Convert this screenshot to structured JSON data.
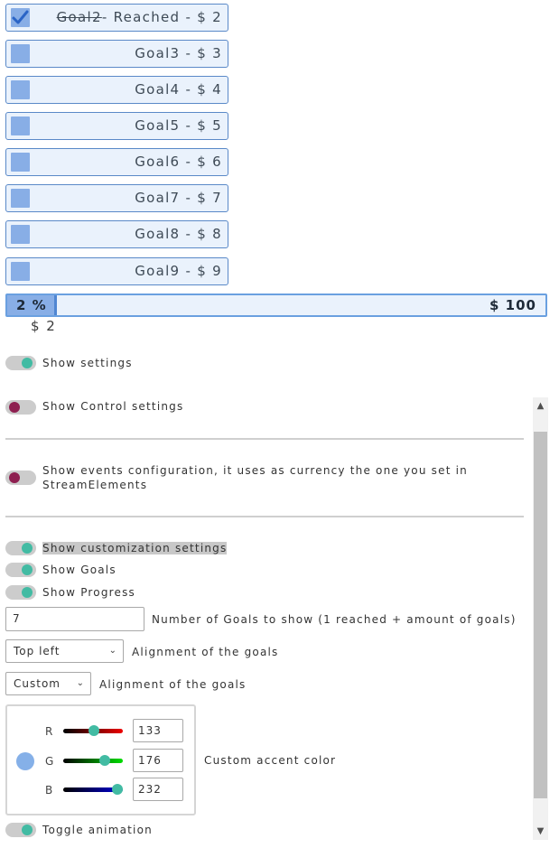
{
  "goals": [
    {
      "name": "Goal2",
      "suffix": "- Reached - $ 2",
      "reached": true
    },
    {
      "label": "Goal3 - $ 3",
      "reached": false
    },
    {
      "label": "Goal4 - $ 4",
      "reached": false
    },
    {
      "label": "Goal5 - $ 5",
      "reached": false
    },
    {
      "label": "Goal6 - $ 6",
      "reached": false
    },
    {
      "label": "Goal7 - $ 7",
      "reached": false
    },
    {
      "label": "Goal8 - $ 8",
      "reached": false
    },
    {
      "label": "Goal9 - $ 9",
      "reached": false
    }
  ],
  "progress": {
    "percent_label": "2 %",
    "target": "$ 100",
    "current": "$ 2",
    "fraction": 0.02
  },
  "settings": {
    "show_settings": {
      "label": "Show settings",
      "on": true
    },
    "show_control": {
      "label": "Show Control settings",
      "on": false
    },
    "show_events": {
      "label": "Show events configuration, it uses as currency the one you set in",
      "label2": "StreamElements",
      "on": false
    },
    "show_custom": {
      "label": "Show customization settings",
      "on": true
    },
    "show_goals": {
      "label": "Show Goals",
      "on": true
    },
    "show_progress": {
      "label": "Show Progress",
      "on": true
    },
    "num_goals": {
      "value": "7",
      "label": "Number of Goals to show (1 reached + amount of goals)"
    },
    "alignment": {
      "value": "Top left",
      "label": "Alignment of the goals"
    },
    "accent_mode": {
      "value": "Custom",
      "label": "Alignment of the goals"
    },
    "accent": {
      "r": {
        "label": "R",
        "value": "133"
      },
      "g": {
        "label": "G",
        "value": "176"
      },
      "b": {
        "label": "B",
        "value": "232"
      },
      "label": "Custom accent color",
      "color": "#85b0e8"
    },
    "toggle_animation": {
      "label": "Toggle animation",
      "on": true
    }
  },
  "colors": {
    "accent": "#88aee6",
    "toggle_on": "#42bba3",
    "toggle_off": "#8e1f50"
  }
}
